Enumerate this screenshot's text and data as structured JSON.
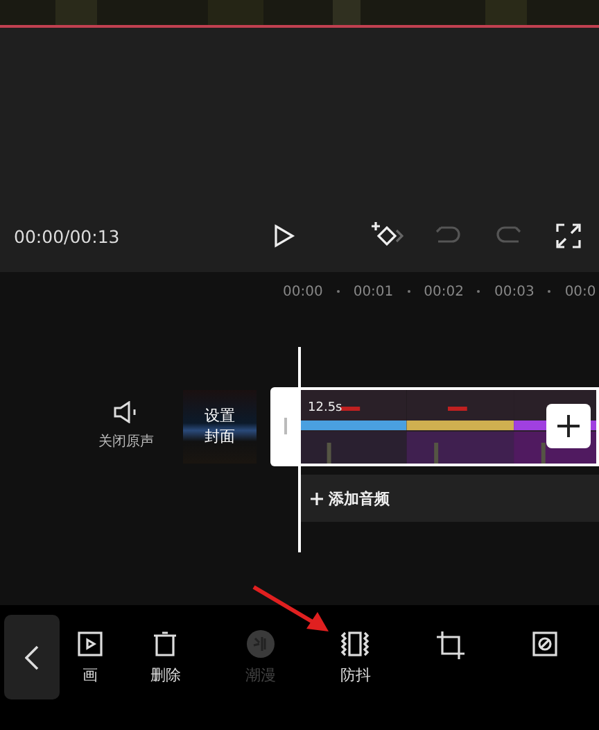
{
  "preview": {
    "time": "00:00/00:13"
  },
  "controls": [
    {
      "kind": "play",
      "disabled": false
    },
    {
      "kind": "keyframe",
      "disabled": false
    },
    {
      "kind": "undo",
      "disabled": true
    },
    {
      "kind": "redo",
      "disabled": true
    },
    {
      "kind": "fullscreen",
      "disabled": false
    }
  ],
  "ruler": [
    "00:00",
    "00:01",
    "00:02",
    "00:03",
    "00:0"
  ],
  "track": {
    "mute_label": "关闭原声",
    "cover_lines": [
      "设置",
      "封面"
    ],
    "clip_duration": "12.5s",
    "add_audio": "添加音频"
  },
  "tools": [
    {
      "kind": "animation",
      "label": "画",
      "disabled": false
    },
    {
      "kind": "delete",
      "label": "删除",
      "disabled": false
    },
    {
      "kind": "comic",
      "label": "潮漫",
      "disabled": true
    },
    {
      "kind": "stabilize",
      "label": "防抖",
      "disabled": false
    },
    {
      "kind": "crop",
      "disabled": false
    },
    {
      "kind": "mask",
      "disabled": false
    }
  ]
}
